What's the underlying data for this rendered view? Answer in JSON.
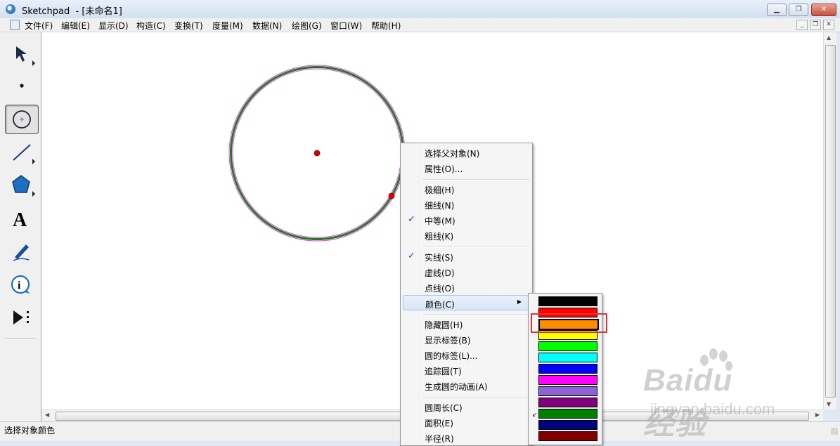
{
  "window": {
    "app_name": "Sketchpad",
    "doc_title": "- [未命名1]"
  },
  "menubar": {
    "items": [
      "文件(F)",
      "编辑(E)",
      "显示(D)",
      "构造(C)",
      "变换(T)",
      "度量(M)",
      "数据(N)",
      "绘图(G)",
      "窗口(W)",
      "帮助(H)"
    ]
  },
  "toolbox": {
    "tools": [
      "selection-arrow-tool",
      "point-tool",
      "compass-tool",
      "straightedge-tool",
      "polygon-tool",
      "text-tool",
      "marker-tool",
      "information-tool",
      "custom-tool"
    ],
    "selected": "compass-tool"
  },
  "canvas": {
    "circle_color": "#1f7a1f",
    "selection_color": "#e040e0",
    "point_color": "#e00000"
  },
  "context_menu": {
    "items": [
      {
        "label": "选择父对象(N)",
        "checked": false
      },
      {
        "label": "属性(O)...",
        "checked": false
      },
      {
        "label": "极细(H)",
        "checked": false
      },
      {
        "label": "细线(N)",
        "checked": false
      },
      {
        "label": "中等(M)",
        "checked": true
      },
      {
        "label": "粗线(K)",
        "checked": false
      },
      {
        "label": "实线(S)",
        "checked": true
      },
      {
        "label": "虚线(D)",
        "checked": false
      },
      {
        "label": "点线(O)",
        "checked": false
      },
      {
        "label": "颜色(C)",
        "checked": false,
        "submenu": true,
        "highlighted": true
      },
      {
        "label": "隐藏圆(H)",
        "checked": false
      },
      {
        "label": "显示标签(B)",
        "checked": false
      },
      {
        "label": "圆的标签(L)...",
        "checked": false
      },
      {
        "label": "追踪圆(T)",
        "checked": false
      },
      {
        "label": "生成圆的动画(A)",
        "checked": false
      },
      {
        "label": "圆周长(C)",
        "checked": false
      },
      {
        "label": "面积(E)",
        "checked": false
      },
      {
        "label": "半径(R)",
        "checked": false
      }
    ],
    "check_glyph": "✓"
  },
  "color_submenu": {
    "swatches": [
      "#000000",
      "#ff0000",
      "#ff8c00",
      "#ffff00",
      "#00ff00",
      "#00ffff",
      "#0000ff",
      "#ff00ff",
      "#8b63d6",
      "#800080",
      "#008000",
      "#000080",
      "#800000"
    ],
    "selected_index": 2
  },
  "statusbar": {
    "text": "选择对象颜色"
  },
  "watermark": {
    "brand": "Baidu经验",
    "url": "jingyan.baidu.com"
  }
}
